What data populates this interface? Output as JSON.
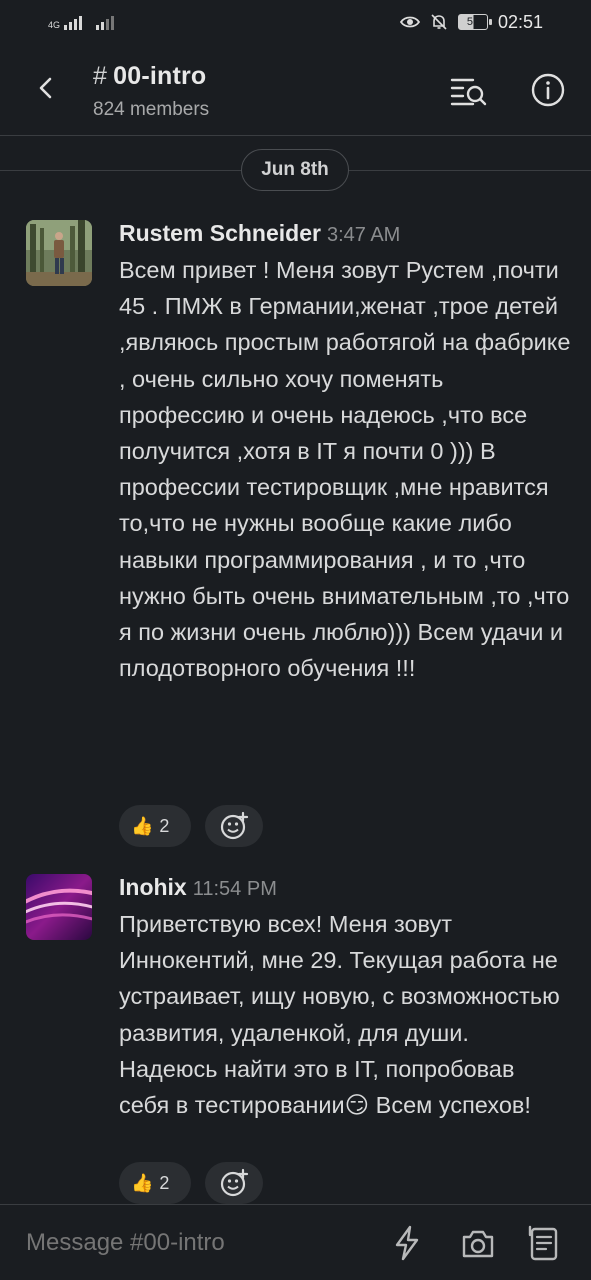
{
  "status_bar": {
    "network_label": "4G",
    "battery": "52",
    "time": "02:51"
  },
  "header": {
    "hash": "#",
    "channel": "00-intro",
    "members": "824 members"
  },
  "date_divider": "Jun 8th",
  "messages": [
    {
      "author": "Rustem Schneider",
      "time": "3:47 AM",
      "text": "Всем привет ! Меня зовут Рустем ,почти 45 . ПМЖ в Германии,женат ,трое детей ,являюсь простым работягой на фабрике , очень сильно хочу поменять профессию и очень надеюсь ,что все получится ,хотя в IT я почти 0 ))) В профессии тестировщик ,мне нравится то,что не нужны вообще какие либо навыки программирования , и то ,что нужно быть очень внимательным ,то ,что я по жизни очень люблю))) Всем удачи и плодотворного обучения !!!",
      "reaction": {
        "emoji": "👍",
        "count": "2"
      }
    },
    {
      "author": "Inohix",
      "time": "11:54 PM",
      "text": "Приветствую всех! Меня зовут Иннокентий, мне 29. Текущая работа не устраивает, ищу новую, с возможностью развития, удаленкой, для души. Надеюсь найти это в IT, попробовав себя в тестировании😏 Всем успехов!",
      "reaction": {
        "emoji": "👍",
        "count": "2"
      }
    }
  ],
  "composer": {
    "placeholder": "Message #00-intro"
  }
}
